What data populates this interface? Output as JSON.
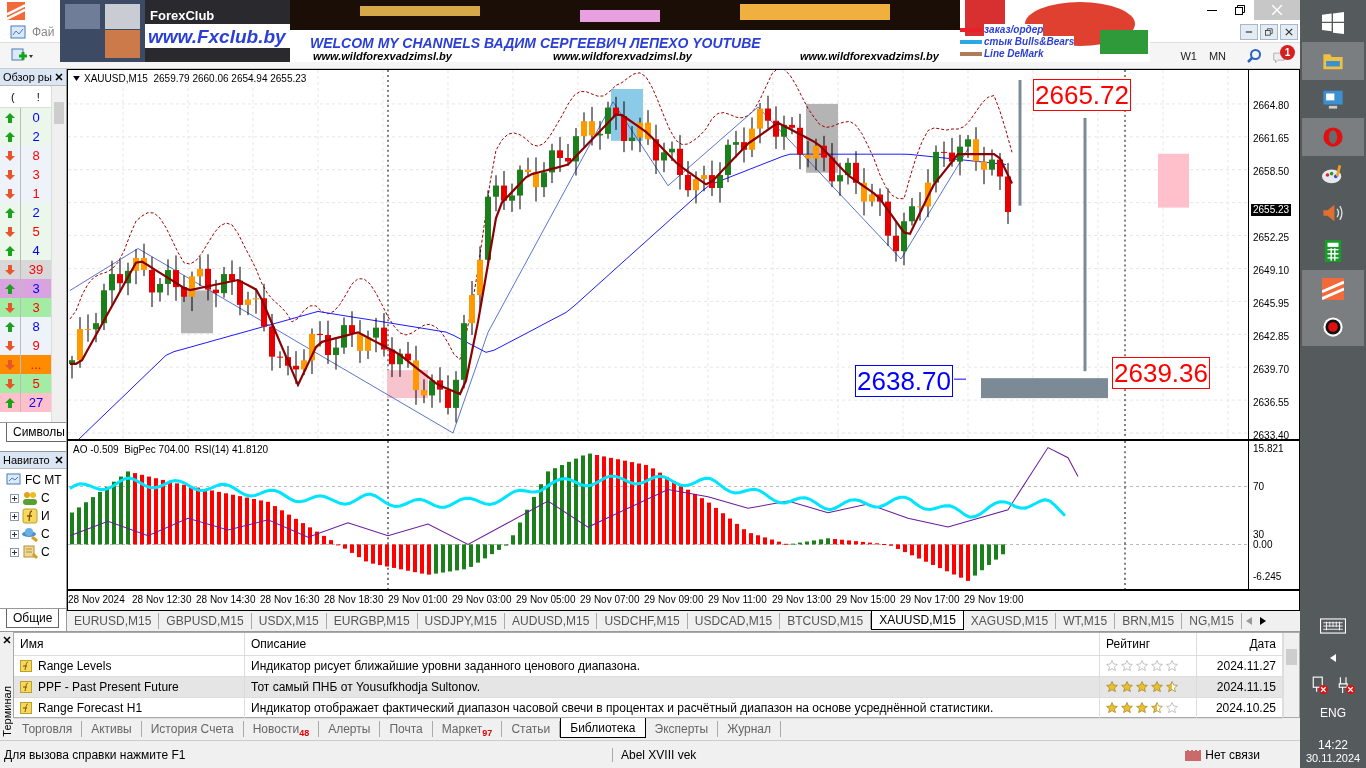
{
  "menu": {
    "items": [
      "Фай"
    ]
  },
  "banner": {
    "brand": "ForexClub",
    "site": "www.Fxclub.by",
    "headline": "WELCOM MY CHANNELS ВАДИМ СЕРГЕЕВИЧ ЛЕПЕХО YOUTUBE",
    "links": [
      "www.wildforexvadzimsl.by",
      "www.wildforexvadzimsl.by",
      "www.wildforexvadzimsl.by"
    ],
    "legend": [
      {
        "label": "заказ/ордер",
        "color": "#e8202a"
      },
      {
        "label": "стык Bulls&Bears",
        "color": "#2aa8e8"
      },
      {
        "label": "Line DeMark",
        "color": "#b07a5a"
      }
    ]
  },
  "toolbar": {
    "periods": [
      "W1",
      "MN"
    ],
    "notifications": "1"
  },
  "market_watch": {
    "title": "Обзор ры",
    "columns": [
      "(",
      "!"
    ],
    "tab": "Символы",
    "rows": [
      {
        "up": true,
        "value": "0",
        "color": "#eaf7ea"
      },
      {
        "up": true,
        "value": "2",
        "color": "#eaf7ea"
      },
      {
        "up": false,
        "value": "8",
        "color": "#eef3fa"
      },
      {
        "up": false,
        "value": "3",
        "color": "#eef3fa"
      },
      {
        "up": false,
        "value": "1",
        "color": "#eef3fa"
      },
      {
        "up": true,
        "value": "2",
        "color": "#eaf7ea"
      },
      {
        "up": false,
        "value": "5",
        "color": "#eaf7ea"
      },
      {
        "up": true,
        "value": "4",
        "color": "#eaf7ea"
      },
      {
        "up": false,
        "value": "39",
        "color": "#d8d8d8"
      },
      {
        "up": true,
        "value": "3",
        "color": "#d9a3e0"
      },
      {
        "up": false,
        "value": "3",
        "color": "#a3eca3"
      },
      {
        "up": true,
        "value": "8",
        "color": "#eef3fa"
      },
      {
        "up": false,
        "value": "9",
        "color": "#eef3fa"
      },
      {
        "up": false,
        "value": "...",
        "color": "#ff8c00"
      },
      {
        "up": false,
        "value": "5",
        "color": "#a3eca3"
      },
      {
        "up": true,
        "value": "27",
        "color": "#ffc0cb"
      }
    ]
  },
  "navigator": {
    "title": "Навигато",
    "tab": "Общие",
    "items": [
      {
        "kind": "terminal",
        "label": "FC MT"
      },
      {
        "kind": "accounts",
        "label": "С"
      },
      {
        "kind": "indicators",
        "label": "И"
      },
      {
        "kind": "experts",
        "label": "С"
      },
      {
        "kind": "scripts",
        "label": "С"
      }
    ]
  },
  "chart": {
    "header": "XAUUSD,M15  2659.79 2660.06 2654.94 2655.23",
    "price_ticks": [
      "2664.80",
      "2661.65",
      "2658.50",
      "2655.23",
      "2652.25",
      "2649.10",
      "2645.95",
      "2642.85",
      "2639.70",
      "2636.55",
      "2633.40"
    ],
    "levels": [
      {
        "label": "2665.72",
        "color": "#ff0000"
      },
      {
        "label": "2639.36",
        "color": "#ff0000"
      },
      {
        "label": "2638.70",
        "color": "#0000ff"
      }
    ],
    "indicator": {
      "header": "AO -0.509  BigPec 704.00  RSI(14) 41.8120",
      "ticks": [
        "15.821",
        "70",
        "30",
        "0.00",
        "-6.245"
      ]
    },
    "time_labels": [
      "28 Nov 2024",
      "28 Nov 12:30",
      "28 Nov 14:30",
      "28 Nov 16:30",
      "28 Nov 18:30",
      "29 Nov 01:00",
      "29 Nov 03:00",
      "29 Nov 05:00",
      "29 Nov 07:00",
      "29 Nov 09:00",
      "29 Nov 11:00",
      "29 Nov 13:00",
      "29 Nov 15:00",
      "29 Nov 17:00",
      "29 Nov 19:00"
    ]
  },
  "chart_tabs": [
    {
      "label": "EURUSD,M15",
      "selected": false
    },
    {
      "label": "GBPUSD,M15",
      "selected": false
    },
    {
      "label": "USDX,M15",
      "selected": false
    },
    {
      "label": "EURGBP,M15",
      "selected": false
    },
    {
      "label": "USDJPY,M15",
      "selected": false
    },
    {
      "label": "AUDUSD,M15",
      "selected": false
    },
    {
      "label": "USDCHF,M15",
      "selected": false
    },
    {
      "label": "USDCAD,M15",
      "selected": false
    },
    {
      "label": "BTCUSD,M15",
      "selected": false
    },
    {
      "label": "XAUUSD,M15",
      "selected": true
    },
    {
      "label": "XAGUSD,M15",
      "selected": false
    },
    {
      "label": "WT,M15",
      "selected": false
    },
    {
      "label": "BRN,M15",
      "selected": false
    },
    {
      "label": "NG,M15",
      "selected": false
    }
  ],
  "terminal": {
    "title": "Терминал",
    "columns": [
      "Имя",
      "Описание",
      "Рейтинг",
      "Дата"
    ],
    "rows": [
      {
        "name": "Range Levels",
        "description": "Индикатор рисует ближайшие уровни заданного ценового диапазона.",
        "stars": 0,
        "date": "2024.11.27",
        "selected": false
      },
      {
        "name": "PPF - Past Present Future",
        "description": "Тот самый ПНБ от Yousufkhodja Sultonov.",
        "stars": 4.5,
        "date": "2024.11.15",
        "selected": true
      },
      {
        "name": "Range Forecast H1",
        "description": "Индикатор отображает фактический диапазон часовой свечи в процентах и расчётный диапазон на основе усреднённой статистики.",
        "stars": 3.5,
        "date": "2024.10.25",
        "selected": false
      }
    ],
    "tabs": [
      {
        "label": "Торговля",
        "selected": false
      },
      {
        "label": "Активы",
        "selected": false
      },
      {
        "label": "История Счета",
        "selected": false
      },
      {
        "label": "Новости",
        "badge": "48",
        "selected": false
      },
      {
        "label": "Алерты",
        "selected": false
      },
      {
        "label": "Почта",
        "selected": false
      },
      {
        "label": "Маркет",
        "badge": "97",
        "selected": false
      },
      {
        "label": "Статьи",
        "selected": false
      },
      {
        "label": "Библиотека",
        "selected": true
      },
      {
        "label": "Эксперты",
        "selected": false
      },
      {
        "label": "Журнал",
        "selected": false
      }
    ]
  },
  "status_bar": {
    "help": "Для вызова справки нажмите F1",
    "profile": "Abel XVIII vek",
    "connection": "Нет связи"
  },
  "taskbar": {
    "language": "ENG",
    "time": "14:22",
    "date": "30.11.2024"
  }
}
